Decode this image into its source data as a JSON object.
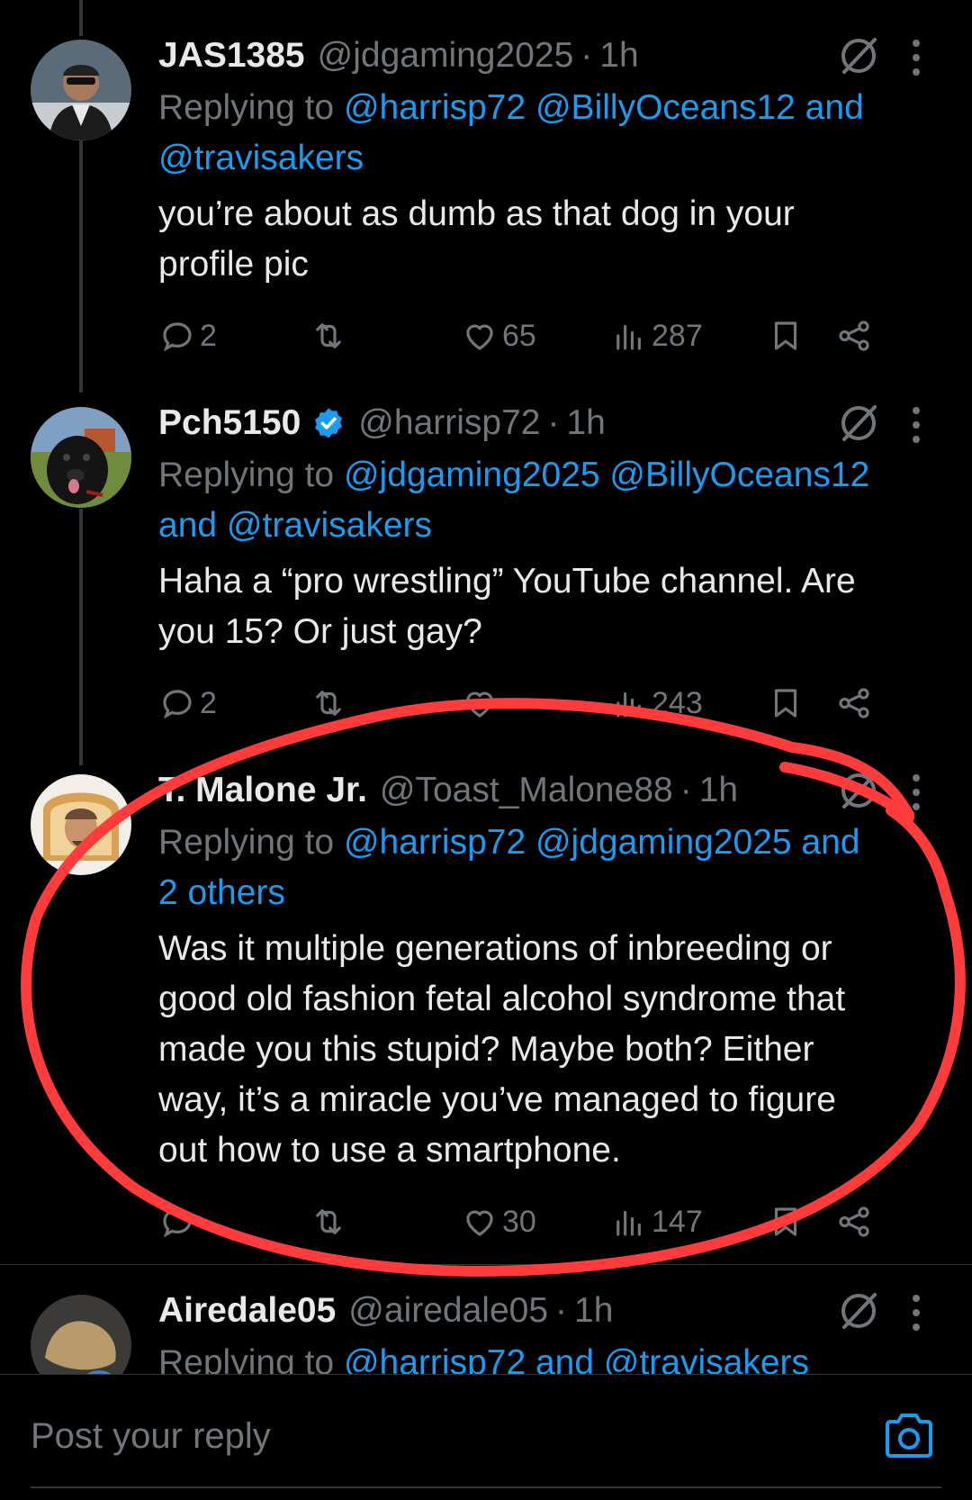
{
  "tweets": [
    {
      "name": "JAS1385",
      "handle": "@jdgaming2025",
      "time": "1h",
      "reply_prefix": "Replying to ",
      "mentions_line1": "@harrisp72 @BillyOceans12 and",
      "mentions_line2": "@travisakers",
      "body_line1": "you’re about as dumb as that dog in your",
      "body_line2": "profile pic",
      "replies": "2",
      "retweets": "",
      "likes": "65",
      "views": "287"
    },
    {
      "name": "Pch5150",
      "verified": true,
      "handle": "@harrisp72",
      "time": "1h",
      "reply_prefix": "Replying to ",
      "mentions_line1": "@jdgaming2025 @BillyOceans12",
      "mentions_line2": "and @travisakers",
      "body_line1": "Haha a “pro wrestling” YouTube channel. Are",
      "body_line2": "you 15? Or just gay?",
      "replies": "2",
      "retweets": "",
      "likes": "",
      "views": "243"
    },
    {
      "name": "T. Malone Jr.",
      "handle": "@Toast_Malone88",
      "time": "1h",
      "reply_prefix": "Replying to ",
      "mentions_line1": "@harrisp72 @jdgaming2025 and",
      "mentions_line2": "2 others",
      "body_line1": "Was it multiple generations of inbreeding or",
      "body_line2": "good old fashion fetal alcohol syndrome that",
      "body_line3": "made you this stupid? Maybe both? Either",
      "body_line4": "way, it’s a miracle you’ve managed to figure",
      "body_line5": "out how to use a smartphone.",
      "replies": "",
      "retweets": "",
      "likes": "30",
      "views": "147"
    },
    {
      "name": "Airedale05",
      "handle": "@airedale05",
      "time": "1h",
      "reply_prefix": "Replying to ",
      "mentions_line1": "@harrisp72 and @travisakers"
    }
  ],
  "composer": {
    "placeholder": "Post your reply"
  },
  "colors": {
    "background": "#000000",
    "text": "#e7e9ea",
    "secondary": "#71767b",
    "accent": "#1d9bf0",
    "annotation": "#ff3b3b"
  },
  "icons": [
    "reply-icon",
    "retweet-icon",
    "like-icon",
    "views-icon",
    "bookmark-icon",
    "share-icon",
    "grok-icon",
    "more-icon",
    "verified-icon",
    "camera-icon"
  ]
}
